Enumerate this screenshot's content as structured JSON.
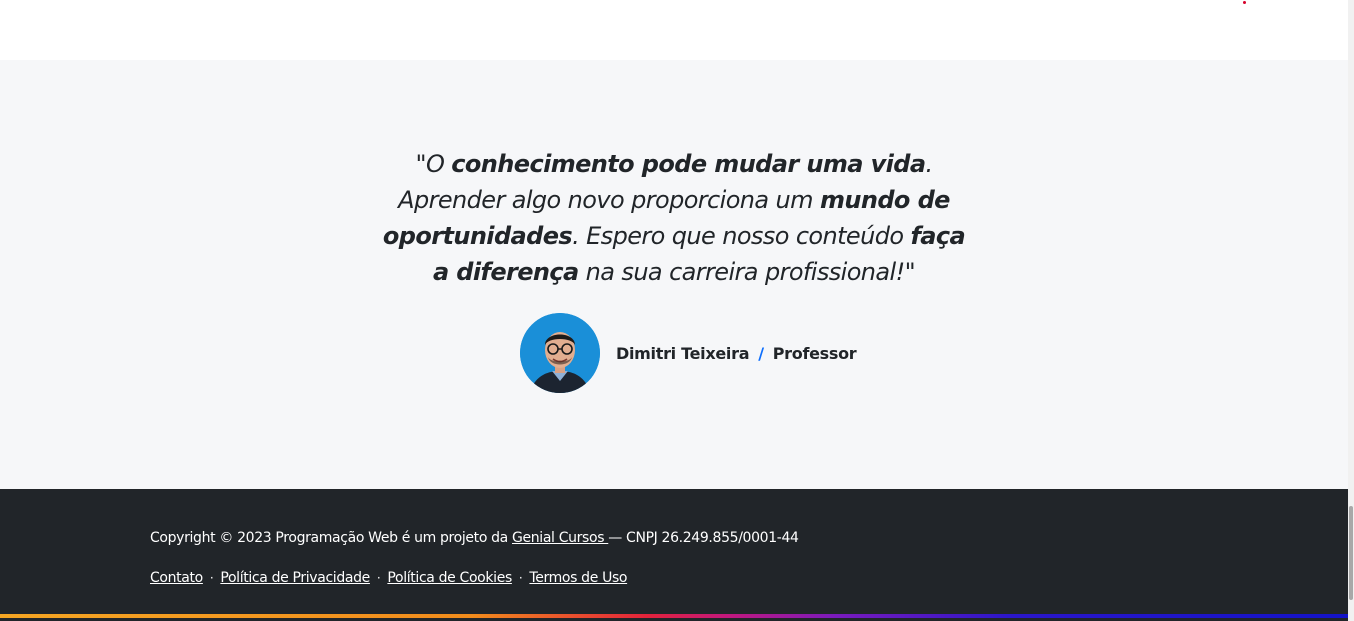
{
  "testimonial": {
    "quote_parts": {
      "p1": "\"O ",
      "b1": "conhecimento pode mudar uma vida",
      "p2": ". Aprender algo novo proporciona um ",
      "b2": "mundo de oportunidades",
      "p3": ". Espero que nosso conteúdo ",
      "b3": "faça a diferença",
      "p4": " na sua carreira profissional!\""
    },
    "author_name": "Dimitri Teixeira",
    "separator": "/",
    "author_role": "Professor"
  },
  "footer": {
    "copyright_prefix": "Copyright © 2023 Programação Web é um projeto da ",
    "company_link": "Genial Cursos ",
    "copyright_suffix": "— CNPJ 26.249.855/0001-44",
    "links": {
      "contato": "Contato",
      "privacidade": "Política de Privacidade",
      "cookies": "Política de Cookies",
      "termos": "Termos de Uso"
    },
    "link_separator": "·"
  },
  "colors": {
    "accent": "#0d6efd",
    "footer_bg": "#212529",
    "section_bg": "#f6f7f9"
  }
}
